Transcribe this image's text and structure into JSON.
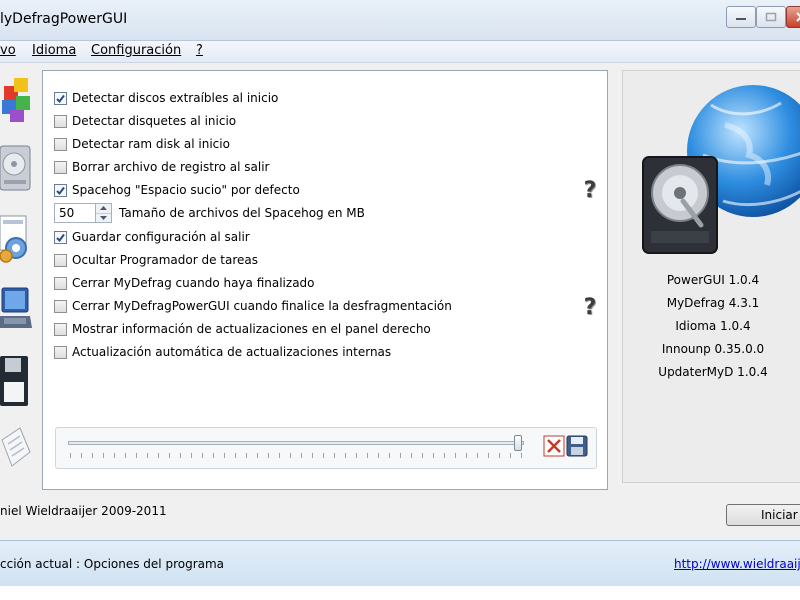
{
  "window": {
    "title": "lyDefragPowerGUI"
  },
  "menu": {
    "items": [
      "vo",
      "Idioma",
      "Configuración",
      "?"
    ]
  },
  "options": {
    "items": [
      {
        "label": "Detectar discos extraíbles al inicio",
        "checked": true
      },
      {
        "label": "Detectar disquetes al inicio",
        "checked": false
      },
      {
        "label": "Detectar ram disk al inicio",
        "checked": false
      },
      {
        "label": "Borrar archivo de registro al salir",
        "checked": false
      },
      {
        "label": "Spacehog \"Espacio sucio\" por defecto",
        "checked": true
      },
      {
        "label": "Guardar configuración al salir",
        "checked": true
      },
      {
        "label": "Ocultar Programador de tareas",
        "checked": false
      },
      {
        "label": "Cerrar MyDefrag cuando haya finalizado",
        "checked": false
      },
      {
        "label": "Cerrar MyDefragPowerGUI cuando finalice la desfragmentación",
        "checked": false
      },
      {
        "label": "Mostrar información de actualizaciones en el panel derecho",
        "checked": false
      },
      {
        "label": "Actualización automática de actualizaciones internas",
        "checked": false
      }
    ],
    "spacehog_size": {
      "value": "50",
      "label": "Tamaño de archivos del Spacehog en MB"
    }
  },
  "slider": {
    "level_percent": 100
  },
  "info": {
    "versions": [
      "PowerGUI 1.0.4",
      "MyDefrag 4.3.1",
      "Idioma 1.0.4",
      "Innounp 0.35.0.0",
      "UpdaterMyD 1.0.4"
    ]
  },
  "footer": {
    "copyright": "niel Wieldraaijer 2009-2011",
    "start_button": "Iniciar"
  },
  "status": {
    "text": "cción actual : Opciones del programa",
    "link": "http://www.wieldraaije"
  },
  "icons": {
    "left": [
      "defrag-blocks-icon",
      "hard-drive-icon",
      "settings-gears-icon",
      "laptop-icon",
      "floppy-disk-icon",
      "document-icon"
    ],
    "help": "help-question-icon",
    "cancel": "cancel-x-icon",
    "save": "save-disk-icon",
    "logo": "hdd-globe-logo"
  },
  "colors": {
    "status_bar": "#d6e6f4",
    "link": "#0000cc",
    "close_button": "#c9402a"
  }
}
